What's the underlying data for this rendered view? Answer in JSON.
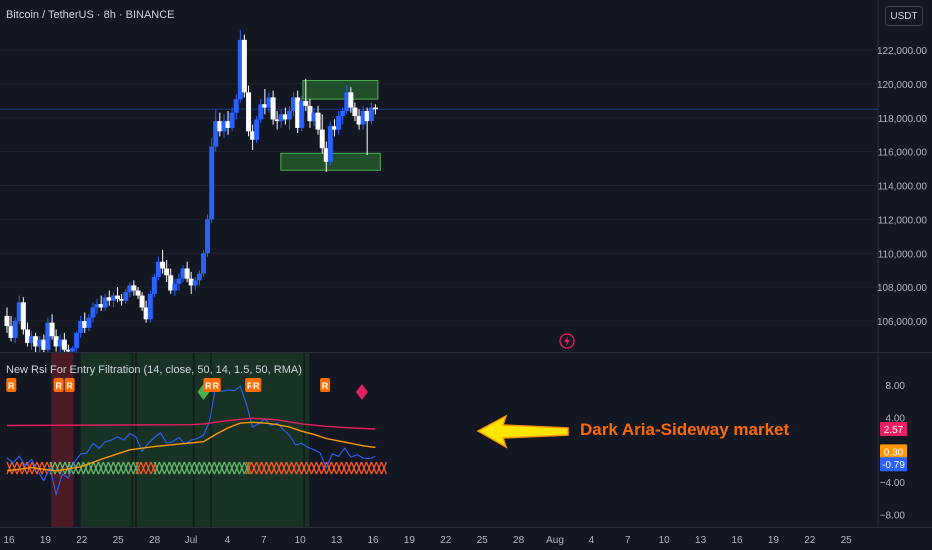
{
  "header": {
    "symbol_line": "Bitcoin / TetherUS · 8h · BINANCE",
    "currency": "USDT"
  },
  "indicator": {
    "legend": "New Rsi For Entry Filtration (14, close, 50, 14, 1.5, 50, RMA)"
  },
  "annotation": {
    "text": "Dark Aria-Sideway market"
  },
  "colors": {
    "bg": "#131722",
    "up": "#2962ff",
    "down": "#ffffff",
    "zone": "#2e7d32",
    "rsi": "#2962ff",
    "signal": "#e91e63",
    "base": "#ff9800",
    "marker": "#ff6d00",
    "annotation": "#ff6a00"
  },
  "chart_data": [
    {
      "type": "candlestick",
      "ylim": [
        104000,
        124000
      ],
      "y_ticks": [
        "106,000.00",
        "108,000.00",
        "110,000.00",
        "112,000.00",
        "114,000.00",
        "116,000.00",
        "118,000.00",
        "120,000.00",
        "122,000.00"
      ],
      "x_ticks": [
        "16",
        "19",
        "22",
        "25",
        "28",
        "Jul",
        "4",
        "7",
        "10",
        "13",
        "16",
        "19",
        "22",
        "25",
        "28",
        "Aug",
        "4",
        "7",
        "10",
        "13",
        "16",
        "19",
        "22",
        "25"
      ],
      "last_price_line": 118500,
      "zones": [
        {
          "name": "resistance-zone",
          "from_day": 24.1,
          "to_day": 30.2,
          "low": 119100,
          "high": 120200
        },
        {
          "name": "support-zone",
          "from_day": 22.3,
          "to_day": 30.4,
          "low": 114900,
          "high": 115900
        }
      ],
      "candles": [
        {
          "d": 0.0,
          "o": 106300,
          "h": 106800,
          "l": 105300,
          "c": 105700
        },
        {
          "d": 0.33,
          "o": 105700,
          "h": 106300,
          "l": 104800,
          "c": 105000
        },
        {
          "d": 0.67,
          "o": 105000,
          "h": 106200,
          "l": 104700,
          "c": 106000
        },
        {
          "d": 1.0,
          "o": 106000,
          "h": 107500,
          "l": 105800,
          "c": 107100
        },
        {
          "d": 1.33,
          "o": 107100,
          "h": 107400,
          "l": 105200,
          "c": 105500
        },
        {
          "d": 1.67,
          "o": 105500,
          "h": 105900,
          "l": 104500,
          "c": 104700
        },
        {
          "d": 2.0,
          "o": 104700,
          "h": 105400,
          "l": 104300,
          "c": 105100
        },
        {
          "d": 2.33,
          "o": 105100,
          "h": 105300,
          "l": 104100,
          "c": 104500
        },
        {
          "d": 2.67,
          "o": 104500,
          "h": 105100,
          "l": 104000,
          "c": 104900
        },
        {
          "d": 3.0,
          "o": 104900,
          "h": 105200,
          "l": 104100,
          "c": 104300
        },
        {
          "d": 3.33,
          "o": 104300,
          "h": 106200,
          "l": 104100,
          "c": 105900
        },
        {
          "d": 3.67,
          "o": 105900,
          "h": 106400,
          "l": 104900,
          "c": 105100
        },
        {
          "d": 4.0,
          "o": 105100,
          "h": 105500,
          "l": 104200,
          "c": 104500
        },
        {
          "d": 4.33,
          "o": 104500,
          "h": 105200,
          "l": 104000,
          "c": 104900
        },
        {
          "d": 4.67,
          "o": 104900,
          "h": 105300,
          "l": 104100,
          "c": 104300
        },
        {
          "d": 5.0,
          "o": 104300,
          "h": 104600,
          "l": 104000,
          "c": 104200
        },
        {
          "d": 5.33,
          "o": 104200,
          "h": 104500,
          "l": 104000,
          "c": 104400
        },
        {
          "d": 5.67,
          "o": 104400,
          "h": 105400,
          "l": 104200,
          "c": 105300
        },
        {
          "d": 6.0,
          "o": 105300,
          "h": 106300,
          "l": 105000,
          "c": 106000
        },
        {
          "d": 6.33,
          "o": 106000,
          "h": 106500,
          "l": 105300,
          "c": 105600
        },
        {
          "d": 6.67,
          "o": 105600,
          "h": 106400,
          "l": 105400,
          "c": 106200
        },
        {
          "d": 7.0,
          "o": 106200,
          "h": 107100,
          "l": 105900,
          "c": 106800
        },
        {
          "d": 7.33,
          "o": 106800,
          "h": 107300,
          "l": 106400,
          "c": 107000
        },
        {
          "d": 7.67,
          "o": 107000,
          "h": 107500,
          "l": 106600,
          "c": 106800
        },
        {
          "d": 8.0,
          "o": 106800,
          "h": 107600,
          "l": 106600,
          "c": 107400
        },
        {
          "d": 8.33,
          "o": 107400,
          "h": 107800,
          "l": 106900,
          "c": 107200
        },
        {
          "d": 8.67,
          "o": 107200,
          "h": 107700,
          "l": 106800,
          "c": 107500
        },
        {
          "d": 9.0,
          "o": 107500,
          "h": 108000,
          "l": 107100,
          "c": 107300
        },
        {
          "d": 9.33,
          "o": 107300,
          "h": 107600,
          "l": 106900,
          "c": 107200
        },
        {
          "d": 9.67,
          "o": 107200,
          "h": 107900,
          "l": 107000,
          "c": 107700
        },
        {
          "d": 10.0,
          "o": 107700,
          "h": 108300,
          "l": 107400,
          "c": 108100
        },
        {
          "d": 10.33,
          "o": 108100,
          "h": 108400,
          "l": 107500,
          "c": 107800
        },
        {
          "d": 10.67,
          "o": 107800,
          "h": 108000,
          "l": 107300,
          "c": 107500
        },
        {
          "d": 11.0,
          "o": 107500,
          "h": 107700,
          "l": 106600,
          "c": 106800
        },
        {
          "d": 11.33,
          "o": 106800,
          "h": 107200,
          "l": 105900,
          "c": 106100
        },
        {
          "d": 11.67,
          "o": 106100,
          "h": 107800,
          "l": 105900,
          "c": 107600
        },
        {
          "d": 12.0,
          "o": 107600,
          "h": 108800,
          "l": 107400,
          "c": 108600
        },
        {
          "d": 12.33,
          "o": 108600,
          "h": 109800,
          "l": 108400,
          "c": 109500
        },
        {
          "d": 12.67,
          "o": 109500,
          "h": 110200,
          "l": 108800,
          "c": 109100
        },
        {
          "d": 13.0,
          "o": 109100,
          "h": 109600,
          "l": 108300,
          "c": 108700
        },
        {
          "d": 13.33,
          "o": 108700,
          "h": 109100,
          "l": 107600,
          "c": 107800
        },
        {
          "d": 13.67,
          "o": 107800,
          "h": 108500,
          "l": 107500,
          "c": 108200
        },
        {
          "d": 14.0,
          "o": 108200,
          "h": 108800,
          "l": 107800,
          "c": 108500
        },
        {
          "d": 14.33,
          "o": 108500,
          "h": 109300,
          "l": 108300,
          "c": 109100
        },
        {
          "d": 14.67,
          "o": 109100,
          "h": 109500,
          "l": 108300,
          "c": 108500
        },
        {
          "d": 15.0,
          "o": 108500,
          "h": 108900,
          "l": 107600,
          "c": 108100
        },
        {
          "d": 15.33,
          "o": 108100,
          "h": 108600,
          "l": 107800,
          "c": 108400
        },
        {
          "d": 15.67,
          "o": 108400,
          "h": 109000,
          "l": 108100,
          "c": 108800
        },
        {
          "d": 16.0,
          "o": 108800,
          "h": 110200,
          "l": 108600,
          "c": 110000
        },
        {
          "d": 16.33,
          "o": 110000,
          "h": 112300,
          "l": 109800,
          "c": 112000
        },
        {
          "d": 16.67,
          "o": 112000,
          "h": 116800,
          "l": 111800,
          "c": 116300
        },
        {
          "d": 17.0,
          "o": 116300,
          "h": 118500,
          "l": 116000,
          "c": 117800
        },
        {
          "d": 17.33,
          "o": 117800,
          "h": 118300,
          "l": 116900,
          "c": 117200
        },
        {
          "d": 17.67,
          "o": 117200,
          "h": 118200,
          "l": 116800,
          "c": 117800
        },
        {
          "d": 18.0,
          "o": 117800,
          "h": 118400,
          "l": 117000,
          "c": 117400
        },
        {
          "d": 18.33,
          "o": 117400,
          "h": 118600,
          "l": 117200,
          "c": 118300
        },
        {
          "d": 18.67,
          "o": 118300,
          "h": 119400,
          "l": 117900,
          "c": 119100
        },
        {
          "d": 19.0,
          "o": 119100,
          "h": 123200,
          "l": 118900,
          "c": 122600
        },
        {
          "d": 19.33,
          "o": 122600,
          "h": 122900,
          "l": 119200,
          "c": 119500
        },
        {
          "d": 19.67,
          "o": 119500,
          "h": 119900,
          "l": 116900,
          "c": 117200
        },
        {
          "d": 20.0,
          "o": 117200,
          "h": 117600,
          "l": 116100,
          "c": 116700
        },
        {
          "d": 20.33,
          "o": 116700,
          "h": 118100,
          "l": 116500,
          "c": 117900
        },
        {
          "d": 20.67,
          "o": 117900,
          "h": 119100,
          "l": 117700,
          "c": 118800
        },
        {
          "d": 21.0,
          "o": 118800,
          "h": 119700,
          "l": 118200,
          "c": 118600
        },
        {
          "d": 21.33,
          "o": 118600,
          "h": 119500,
          "l": 118300,
          "c": 119200
        },
        {
          "d": 21.67,
          "o": 119200,
          "h": 119600,
          "l": 117600,
          "c": 117900
        },
        {
          "d": 22.0,
          "o": 117900,
          "h": 118400,
          "l": 117300,
          "c": 117800
        },
        {
          "d": 22.33,
          "o": 117800,
          "h": 118500,
          "l": 117400,
          "c": 118200
        },
        {
          "d": 22.67,
          "o": 118200,
          "h": 118600,
          "l": 117600,
          "c": 117900
        },
        {
          "d": 23.0,
          "o": 117900,
          "h": 118700,
          "l": 117300,
          "c": 118400
        },
        {
          "d": 23.33,
          "o": 118400,
          "h": 119500,
          "l": 118100,
          "c": 119200
        },
        {
          "d": 23.67,
          "o": 119200,
          "h": 119600,
          "l": 117100,
          "c": 117400
        },
        {
          "d": 24.0,
          "o": 117400,
          "h": 119300,
          "l": 117200,
          "c": 119000
        },
        {
          "d": 24.33,
          "o": 119000,
          "h": 120300,
          "l": 118400,
          "c": 118700
        },
        {
          "d": 24.67,
          "o": 118700,
          "h": 119100,
          "l": 117400,
          "c": 117800
        },
        {
          "d": 25.0,
          "o": 117800,
          "h": 118600,
          "l": 117500,
          "c": 118300
        },
        {
          "d": 25.33,
          "o": 118300,
          "h": 118700,
          "l": 117000,
          "c": 117300
        },
        {
          "d": 25.67,
          "o": 117300,
          "h": 118200,
          "l": 115900,
          "c": 116200
        },
        {
          "d": 26.0,
          "o": 116200,
          "h": 116600,
          "l": 114800,
          "c": 115400
        },
        {
          "d": 26.33,
          "o": 115400,
          "h": 117800,
          "l": 115200,
          "c": 117500
        },
        {
          "d": 26.67,
          "o": 117500,
          "h": 117900,
          "l": 116900,
          "c": 117300
        },
        {
          "d": 27.0,
          "o": 117300,
          "h": 118400,
          "l": 117000,
          "c": 118100
        },
        {
          "d": 27.33,
          "o": 118100,
          "h": 118600,
          "l": 117600,
          "c": 118400
        },
        {
          "d": 27.67,
          "o": 118400,
          "h": 119900,
          "l": 118200,
          "c": 119500
        },
        {
          "d": 28.0,
          "o": 119500,
          "h": 119800,
          "l": 118300,
          "c": 118600
        },
        {
          "d": 28.33,
          "o": 118600,
          "h": 118900,
          "l": 117800,
          "c": 118100
        },
        {
          "d": 28.67,
          "o": 118100,
          "h": 118500,
          "l": 117300,
          "c": 117600
        },
        {
          "d": 29.0,
          "o": 117600,
          "h": 118700,
          "l": 117300,
          "c": 118400
        },
        {
          "d": 29.33,
          "o": 118400,
          "h": 118600,
          "l": 115800,
          "c": 117800
        },
        {
          "d": 29.67,
          "o": 117800,
          "h": 118900,
          "l": 117600,
          "c": 118600
        },
        {
          "d": 30.0,
          "o": 118600,
          "h": 118800,
          "l": 118200,
          "c": 118500
        }
      ]
    },
    {
      "type": "line",
      "title": "New Rsi For Entry Filtration (14, close, 50, 14, 1.5, 50, RMA)",
      "ylim": [
        -10,
        12
      ],
      "y_ticks": [
        "8.00",
        "4.00",
        "−4.00",
        "−8.00"
      ],
      "last_values": {
        "signal": "2.57",
        "base": "0.30",
        "rsi": "-0.79"
      },
      "series": [
        {
          "key": "rsi",
          "x": [
            0,
            0.5,
            1,
            1.5,
            2,
            2.5,
            3,
            3.5,
            4,
            4.5,
            5,
            5.5,
            6,
            6.5,
            7,
            7.5,
            8,
            8.5,
            9,
            9.5,
            10,
            10.5,
            11,
            11.5,
            12,
            12.5,
            13,
            13.5,
            14,
            14.5,
            15,
            15.5,
            16,
            16.5,
            17,
            17.5,
            18,
            18.5,
            19,
            19.5,
            20,
            20.5,
            21,
            21.5,
            22,
            22.5,
            23,
            23.5,
            24,
            24.5,
            25,
            25.5,
            26,
            26.5,
            27,
            27.5,
            28,
            28.5,
            29,
            29.5,
            30
          ],
          "values": [
            -1.0,
            -1.6,
            -0.8,
            -2.0,
            -1.2,
            -2.6,
            -3.8,
            -2.2,
            -5.5,
            -3.0,
            -3.5,
            -1.5,
            -0.5,
            -0.4,
            0.8,
            0.2,
            1.0,
            1.2,
            1.6,
            1.2,
            2.0,
            1.6,
            -0.2,
            0.8,
            1.5,
            2.1,
            0.8,
            1.0,
            1.5,
            0.7,
            1.2,
            1.4,
            1.8,
            3.5,
            8.0,
            7.2,
            7.4,
            7.3,
            7.8,
            5.6,
            2.8,
            3.2,
            3.8,
            3.0,
            3.3,
            2.5,
            1.8,
            0.6,
            0.8,
            0.3,
            0.0,
            -0.4,
            -2.2,
            -0.5,
            -0.8,
            0.2,
            -0.9,
            -0.6,
            -1.0,
            -1.1,
            -0.79
          ]
        },
        {
          "key": "base",
          "x": [
            0,
            2,
            4,
            6,
            8,
            10,
            12,
            14,
            16,
            17,
            18,
            19,
            20,
            21,
            22,
            23,
            24,
            25,
            26,
            27,
            28,
            29,
            30
          ],
          "values": [
            -2.6,
            -2.2,
            -2.6,
            -2.1,
            -1.0,
            0.0,
            0.4,
            0.7,
            1.0,
            1.9,
            2.7,
            3.3,
            3.4,
            3.3,
            3.1,
            2.8,
            2.3,
            1.9,
            1.4,
            1.1,
            0.8,
            0.5,
            0.3
          ]
        },
        {
          "key": "signal",
          "x": [
            0,
            15,
            16,
            18,
            20,
            22,
            24,
            26,
            28,
            30
          ],
          "values": [
            3.0,
            3.1,
            3.2,
            3.6,
            3.9,
            3.7,
            3.2,
            2.9,
            2.7,
            2.57
          ]
        }
      ],
      "shaded_periods": [
        {
          "from_day": 3.6,
          "to_day": 5.4,
          "color": "red"
        },
        {
          "from_day": 6.0,
          "to_day": 16.0,
          "color": "green"
        },
        {
          "from_day": 16.0,
          "to_day": 24.6,
          "color": "green"
        }
      ],
      "markers": [
        {
          "type": "R",
          "day": 0.35
        },
        {
          "type": "R",
          "day": 4.2
        },
        {
          "type": "R",
          "day": 5.1
        },
        {
          "type": "diamond-green",
          "day": 16.0
        },
        {
          "type": "R",
          "day": 16.4
        },
        {
          "type": "R",
          "day": 17.0
        },
        {
          "type": "R",
          "day": 19.8
        },
        {
          "type": "R",
          "day": 20.3
        },
        {
          "type": "R",
          "day": 25.9
        },
        {
          "type": "diamond-pink",
          "day": 28.9
        }
      ],
      "momentum_bar": [
        {
          "from_day": 0,
          "to_day": 3.5,
          "color": "red"
        },
        {
          "from_day": 3.5,
          "to_day": 5.0,
          "color": "green"
        },
        {
          "from_day": 5.0,
          "to_day": 10.5,
          "color": "green"
        },
        {
          "from_day": 10.5,
          "to_day": 12.0,
          "color": "red"
        },
        {
          "from_day": 12.0,
          "to_day": 19.5,
          "color": "green"
        },
        {
          "from_day": 19.5,
          "to_day": 30.6,
          "color": "red"
        }
      ]
    }
  ]
}
